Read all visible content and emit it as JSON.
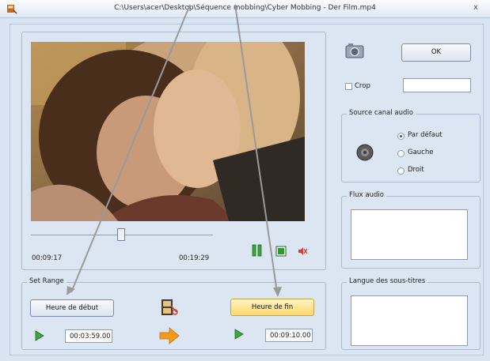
{
  "window": {
    "title": "C:\\Users\\acer\\Desktop\\Séquence mobbing\\Cyber Mobbing - Der Film.mp4",
    "close_glyph": "x"
  },
  "player": {
    "current_time": "00:09:17",
    "total_time": "00:19:29",
    "seek_position": 0.49
  },
  "side": {
    "ok_label": "OK",
    "crop_label": "Crop",
    "crop_value": "",
    "audio_source": {
      "legend": "Source canal audio",
      "options": [
        "Par défaut",
        "Gauche",
        "Droit"
      ],
      "selected": "Par défaut"
    },
    "audio_stream_legend": "Flux audio",
    "subtitles_legend": "Langue des sous-titres"
  },
  "range": {
    "legend": "Set Range",
    "start_button": "Heure de début",
    "end_button": "Heure de fin",
    "start_value": "00:03:59.00",
    "end_value": "00:09:10.00"
  },
  "colors": {
    "accent_green": "#3aa83a",
    "arrow_orange": "#f39a1d",
    "highlight_button": "#ffd86a"
  }
}
